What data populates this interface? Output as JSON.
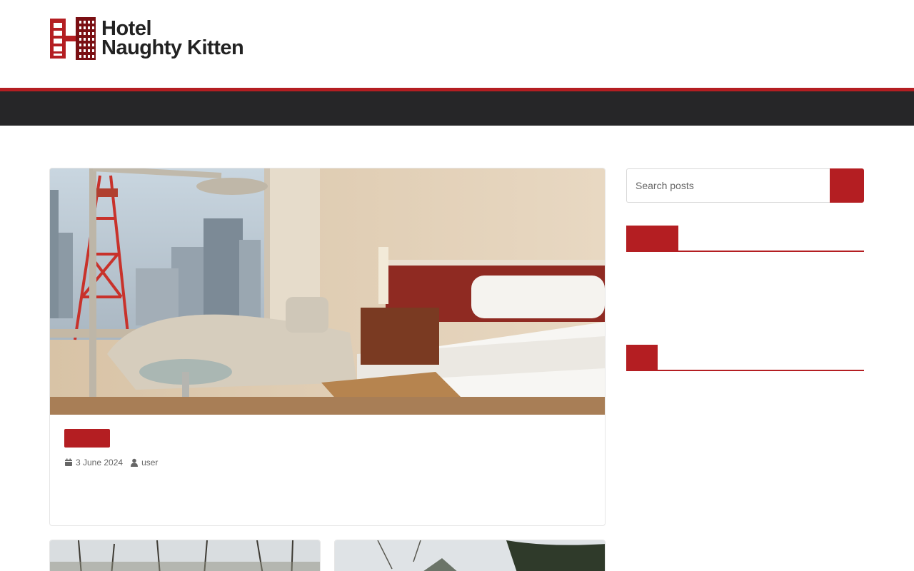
{
  "site": {
    "logo_line1": "Hotel",
    "logo_line2": "Naughty Kitten",
    "brand_color": "#b41e22",
    "nav_color": "#262628"
  },
  "featured_post": {
    "image_alt": "Hotel room with bed and lounge chair overlooking Tokyo Tower",
    "category_label": "",
    "date": "3 June 2024",
    "author": "user",
    "date_icon": "calendar-icon",
    "author_icon": "user-icon"
  },
  "sidebar": {
    "search_placeholder": "Search posts",
    "search_icon": "search-icon",
    "widget1_title": "",
    "widget2_title": ""
  }
}
